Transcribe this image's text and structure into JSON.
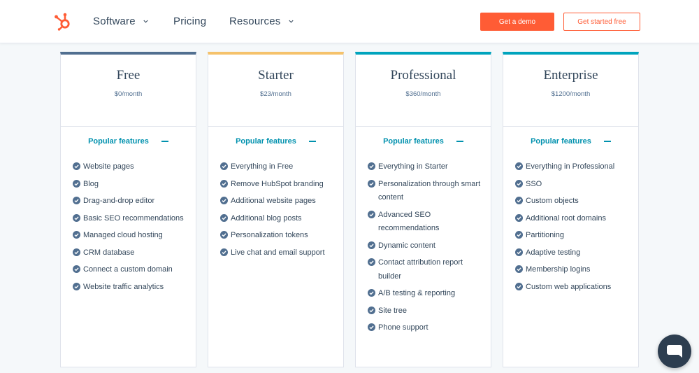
{
  "nav": {
    "items": [
      {
        "label": "Software",
        "has_dropdown": true
      },
      {
        "label": "Pricing",
        "has_dropdown": false
      },
      {
        "label": "Resources",
        "has_dropdown": true
      }
    ],
    "demo_button": "Get a demo",
    "free_button": "Get started free",
    "brand_color": "#ff5c35"
  },
  "plans": [
    {
      "name": "Free",
      "price": "$0/month",
      "accent": "#516f90",
      "features_heading": "Popular features",
      "features": [
        "Website pages",
        "Blog",
        "Drag-and-drop editor",
        "Basic SEO recommendations",
        "Managed cloud hosting",
        "CRM database",
        "Connect a custom domain",
        "Website traffic analytics"
      ]
    },
    {
      "name": "Starter",
      "price": "$23/month",
      "accent": "#f5c26b",
      "features_heading": "Popular features",
      "features": [
        "Everything in Free",
        "Remove HubSpot branding",
        "Additional website pages",
        "Additional blog posts",
        "Personalization tokens",
        "Live chat and email support"
      ]
    },
    {
      "name": "Professional",
      "price": "$360/month",
      "accent": "#00a4bd",
      "features_heading": "Popular features",
      "features": [
        "Everything in Starter",
        "Personalization through smart content",
        "Advanced SEO recommendations",
        "Dynamic content",
        "Contact attribution report builder",
        "A/B testing & reporting",
        "Site tree",
        "Phone support"
      ]
    },
    {
      "name": "Enterprise",
      "price": "$1200/month",
      "accent": "#00a4bd",
      "features_heading": "Popular features",
      "features": [
        "Everything in Professional",
        "SSO",
        "Custom objects",
        "Additional root domains",
        "Partitioning",
        "Adaptive testing",
        "Membership logins",
        "Custom web applications"
      ]
    }
  ],
  "icons": {
    "logo": "hubspot-sprocket-icon",
    "check": "check-circle-icon",
    "collapse": "minus-icon",
    "chat": "chat-bubble-icon"
  }
}
